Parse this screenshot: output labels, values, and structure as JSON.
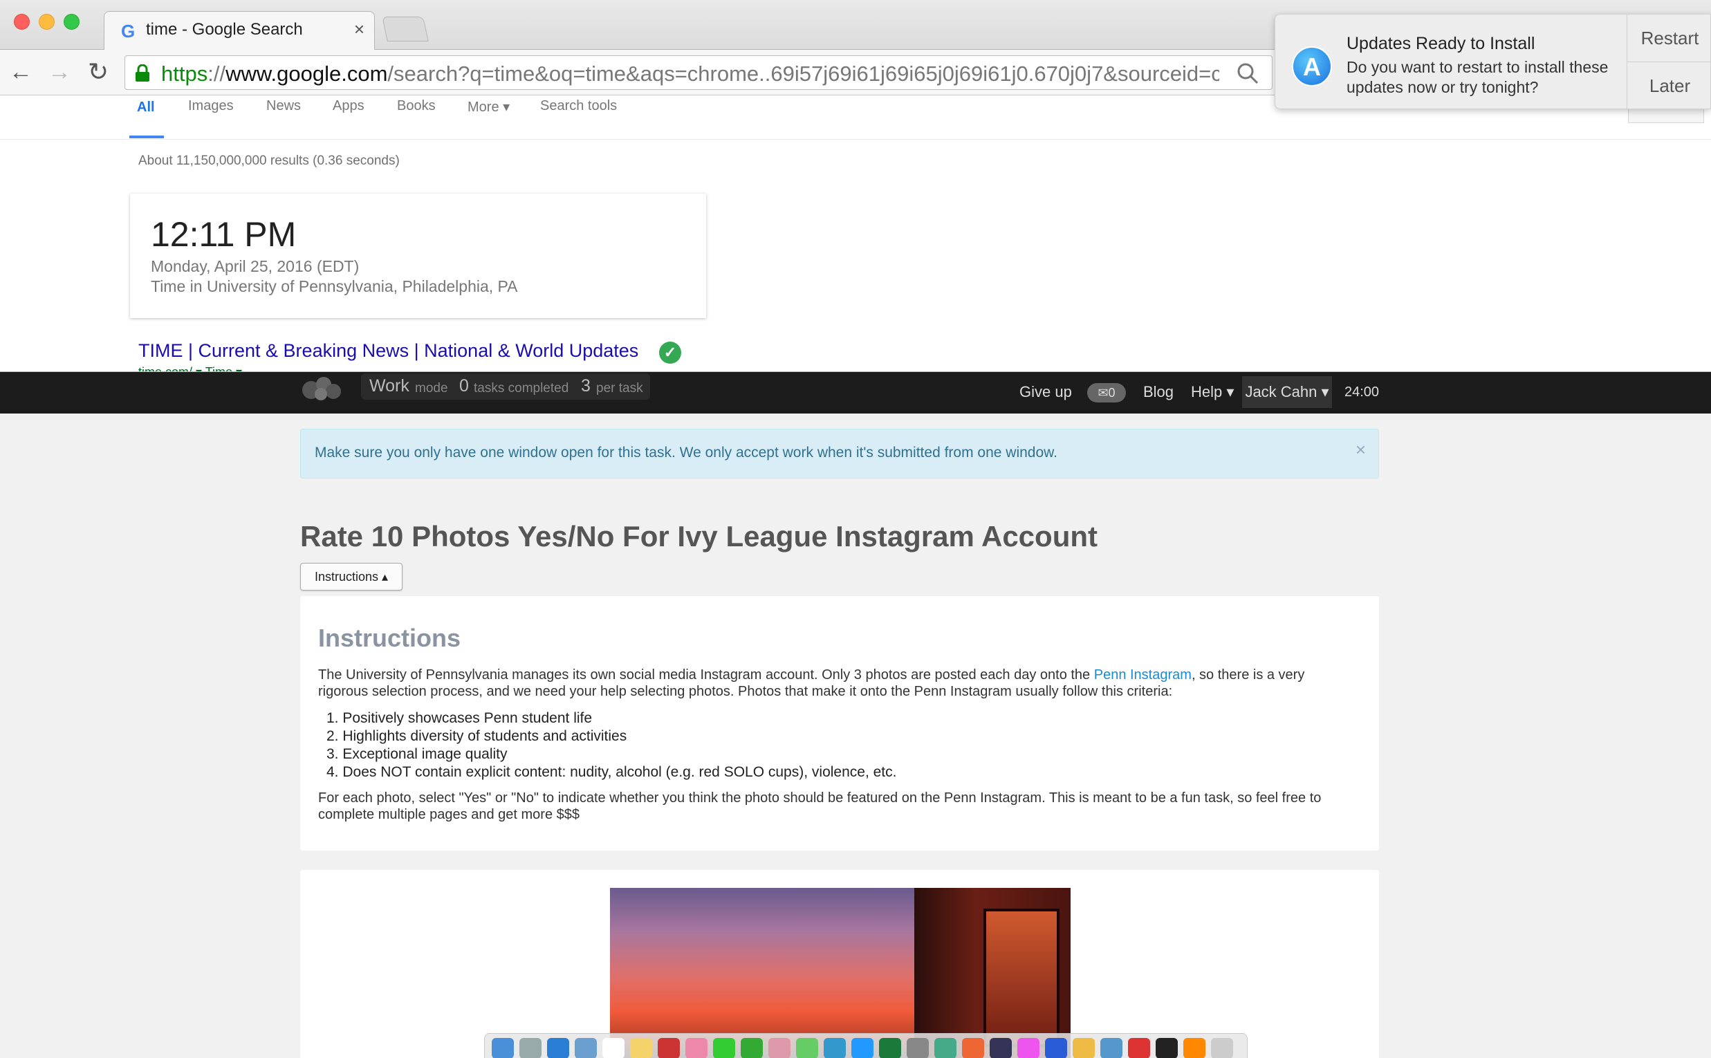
{
  "browser": {
    "tab_title": "time - Google Search",
    "tab_close": "×",
    "url_scheme": "https",
    "url_sep": "://",
    "url_host": "www.google.com",
    "url_rest": "/search?q=time&oq=time&aqs=chrome..69i57j69i61j69i65j0j69i61j0.670j0j7&sourceid=chr…"
  },
  "google": {
    "tabs": [
      "All",
      "Images",
      "News",
      "Apps",
      "Books",
      "More ▾",
      "Search tools"
    ],
    "result_stats": "About 11,150,000,000 results (0.36 seconds)",
    "time_value": "12:11 PM",
    "time_date": "Monday, April 25, 2016 (EDT)",
    "time_place": "Time in University of Pennsylvania, Philadelphia, PA",
    "result_link": "TIME | Current & Breaking News | National & World Updates",
    "result_url": "time.com/ ▾ Time ▾"
  },
  "notification": {
    "title": "Updates Ready to Install",
    "body": "Do you want to restart to install these updates now or try tonight?",
    "restart": "Restart",
    "later": "Later"
  },
  "work_nav": {
    "mode_word": "Work",
    "mode_label": "mode",
    "tasks_count": "0",
    "tasks_label": "tasks completed",
    "per_count": "3",
    "per_label": "per task",
    "give_up": "Give up",
    "messages": "✉0",
    "blog": "Blog",
    "help": "Help ▾",
    "user": "Jack Cahn ▾",
    "timer": "24:00"
  },
  "alert": {
    "text": "Make sure you only have one window open for this task. We only accept work when it's submitted from one window.",
    "close": "×"
  },
  "task": {
    "title": "Rate 10 Photos Yes/No For Ivy League Instagram Account",
    "instructions_button": "Instructions ▴",
    "instructions_heading": "Instructions",
    "p1_before": "The University of Pennsylvania manages its own social media Instagram account. Only 3 photos are posted each day onto the ",
    "p1_link": "Penn Instagram",
    "p1_after": ", so there is a very rigorous selection process, and we need your help selecting photos. Photos that make it onto the Penn Instagram usually follow this criteria:",
    "criteria": [
      "1. Positively showcases Penn student life",
      "2. Highlights diversity of students and activities",
      "3. Exceptional image quality",
      "4. Does NOT contain explicit content: nudity, alcohol (e.g. red SOLO cups), violence, etc."
    ],
    "p2": "For each photo, select \"Yes\" or \"No\" to indicate whether you think the photo should be featured on the Penn Instagram. This is meant to be a fun task, so feel free to complete multiple pages and get more $$$"
  },
  "colors": {
    "accent_blue": "#4285f4",
    "link_blue": "#1a0dab",
    "alert_bg": "#d9edf7",
    "nav_bg": "#1c1c1c"
  },
  "dock_icons": [
    "finder-icon",
    "launchpad-icon",
    "safari-icon",
    "preview-icon",
    "calendar-icon",
    "notes-icon",
    "photo-booth-icon",
    "photos-icon",
    "messages-icon",
    "facetime-icon",
    "itunes-photos-icon",
    "maps-icon",
    "keynote-icon",
    "app-store-icon",
    "excel-icon",
    "system-prefs-icon",
    "network-icon",
    "office-icon",
    "eclipse-icon",
    "itunes-icon",
    "word-icon",
    "chrome-icon",
    "mail-icon",
    "powerpoint-icon",
    "terminal-icon",
    "sublime-icon",
    "trash-icon"
  ]
}
